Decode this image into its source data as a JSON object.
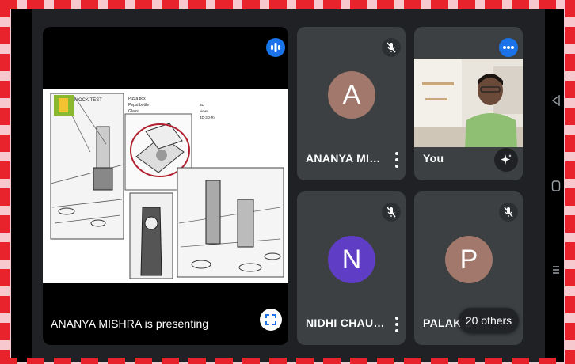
{
  "presenter": {
    "caption": "ANANYA MISHRA is presenting",
    "slide_title": "MOCK TEST",
    "slide_notes": [
      "Pizza box",
      "Pepsi bottle",
      "Glass"
    ],
    "slide_notes_right": [
      "3D",
      "views",
      "4D-3D-R4"
    ]
  },
  "tiles": [
    {
      "name": "ANANYA MI…",
      "initial": "A",
      "avatar_color": "#a1786b"
    },
    {
      "name": "You"
    },
    {
      "name": "NIDHI CHAU…",
      "initial": "N",
      "avatar_color": "#5f3dc4"
    },
    {
      "name": "PALAK S",
      "initial": "P",
      "avatar_color": "#a1786b",
      "overflow_label": "20 others"
    }
  ]
}
